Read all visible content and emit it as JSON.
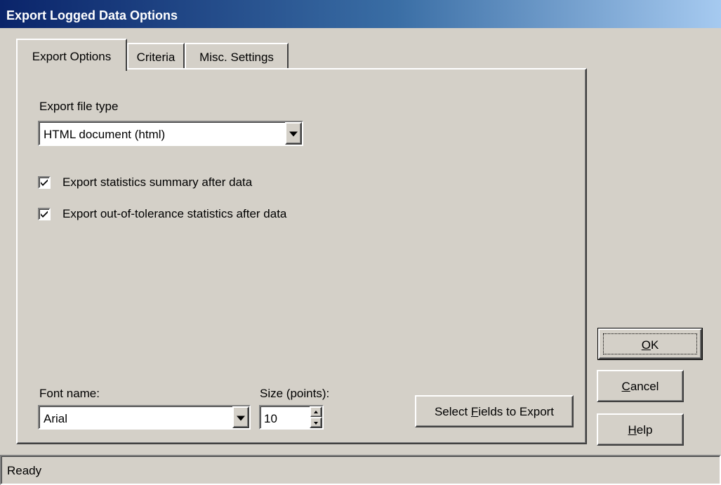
{
  "window": {
    "title": "Export Logged Data Options"
  },
  "tabs": [
    {
      "label": "Export Options"
    },
    {
      "label": "Criteria"
    },
    {
      "label": "Misc. Settings"
    }
  ],
  "export_options": {
    "file_type_label": "Export file type",
    "file_type_value": "HTML document (html)",
    "checkbox_stats": {
      "label": "Export statistics summary after data",
      "checked": true
    },
    "checkbox_oot": {
      "label": "Export out-of-tolerance statistics after data",
      "checked": true
    },
    "font_name_label": "Font name:",
    "font_name_value": "Arial",
    "size_label": "Size (points):",
    "size_value": "10",
    "select_fields_button": {
      "pre": "Select ",
      "accel": "F",
      "post": "ields to Export"
    }
  },
  "buttons": {
    "ok": {
      "pre": "",
      "accel": "O",
      "post": "K"
    },
    "cancel": {
      "pre": "",
      "accel": "C",
      "post": "ancel"
    },
    "help": {
      "pre": "",
      "accel": "H",
      "post": "elp"
    }
  },
  "status": {
    "text": "Ready"
  }
}
